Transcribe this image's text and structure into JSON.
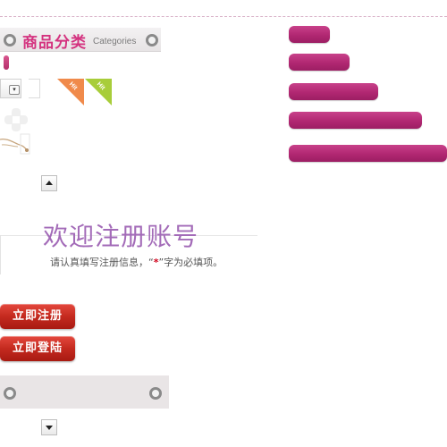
{
  "category_header": {
    "title": "商品分类",
    "subtitle": "Categories"
  },
  "badges": [
    {
      "label": "Hit",
      "color": "#f08a4b"
    },
    {
      "label": "Hit",
      "color": "#a8cd3a"
    }
  ],
  "registration": {
    "title": "欢迎注册账号",
    "hint_prefix": "请认真填写注册信息，“",
    "hint_star": "*",
    "hint_suffix": "”字为必填项。"
  },
  "buttons": {
    "register": "立即注册",
    "login": "立即登陆"
  },
  "colors": {
    "accent_pink": "#b12772",
    "title_pink": "#d4327f",
    "title_purple": "#a36bb8",
    "button_red": "#c42a1f"
  },
  "icons": {
    "ring": "ring-icon",
    "arrow_up": "arrow-up-icon",
    "arrow_down": "arrow-down-icon"
  }
}
